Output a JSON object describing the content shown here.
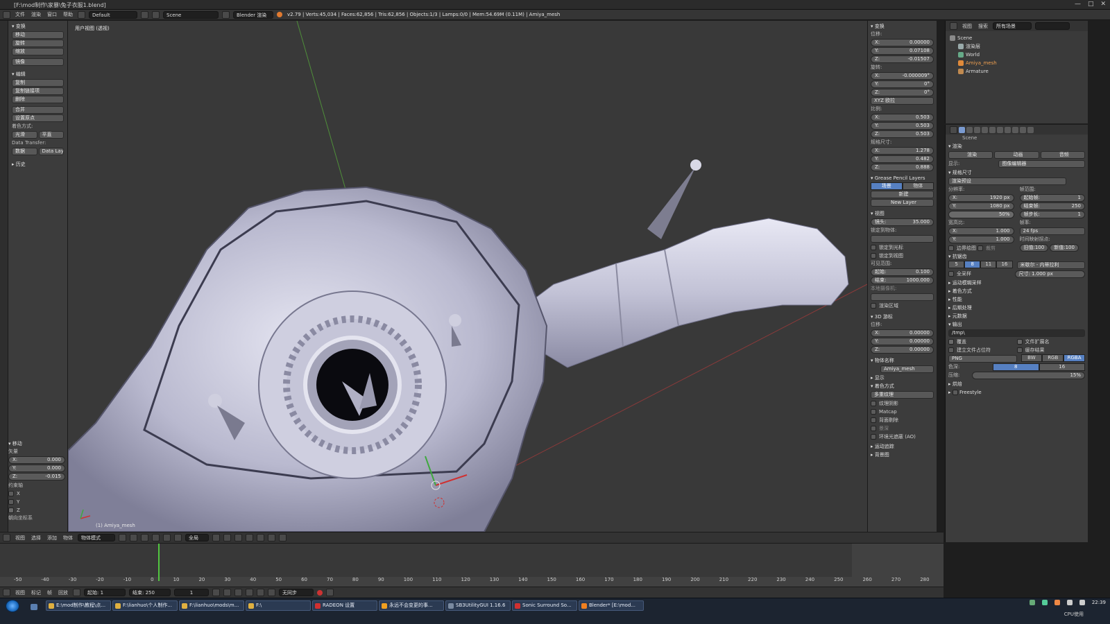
{
  "titlebar": {
    "title": "[F:\\mod制作\\家暴\\兔子衣服1.blend]"
  },
  "infobar": {
    "menus": [
      "文件",
      "渲染",
      "窗口",
      "帮助"
    ],
    "layout": "Default",
    "scene": "Scene",
    "engine": "Blender 渲染",
    "stats": "v2.79 | Verts:45,034 | Faces:62,856 | Tris:62,856 | Objects:1/3 | Lamps:0/0 | Mem:54.69M (0.11M) | Amiya_mesh"
  },
  "toolshelf": {
    "transform": {
      "header": "变换",
      "buttons": [
        "移动",
        "旋转",
        "缩放",
        "镜像"
      ]
    },
    "edit": {
      "header": "编辑",
      "buttons": [
        "复制",
        "复制链接项",
        "删除",
        "合并"
      ],
      "origin": "设置原点",
      "shading_label": "着色方式:",
      "shading": [
        "光滑",
        "平直"
      ],
      "data_transfer_label": "Data Transfer:",
      "data_transfer": [
        "数据",
        "Data Layo"
      ]
    },
    "history": "历史",
    "operator": {
      "header": "移动",
      "vector": "矢量",
      "x": "0.000",
      "y": "0.000",
      "z": "-0.015",
      "constraint": "约束轴",
      "axes": [
        "X",
        "Y",
        "Z"
      ],
      "orient": "朝向坐标系"
    }
  },
  "viewport": {
    "title": "用户视图 (透视)",
    "object": "(1) Amiya_mesh"
  },
  "viewheader": {
    "menus": [
      "视图",
      "选择",
      "添加",
      "物体"
    ],
    "mode": "物体模式",
    "pivot": "全局"
  },
  "npanel": {
    "transform": {
      "header": "变换",
      "location_label": "位移:",
      "location": {
        "x": "0.00000",
        "y": "0.07108",
        "z": "-0.01507"
      },
      "rotation_label": "旋转:",
      "rotation": {
        "x": "-0.000009°",
        "y": "0°",
        "z": "0°"
      },
      "rot_mode": "XYZ 欧拉",
      "scale_label": "比例:",
      "scale": {
        "x": "0.503",
        "y": "0.503",
        "z": "0.503"
      },
      "dims_label": "规格尺寸:",
      "dims": {
        "x": "1.278",
        "y": "0.482",
        "z": "0.888"
      }
    },
    "gpencil": {
      "header": "Grease Pencil Layers",
      "tabs": [
        "场景",
        "物体"
      ],
      "new": "新建",
      "new_layer": "New Layer"
    },
    "view": {
      "header": "视图",
      "lens": "35.000",
      "lens_label": "镜头:",
      "lock_label": "锁定到物体:",
      "lock_cursor": "锁定到光标",
      "lock_camera": "锁定到视图",
      "clip_label": "可见范围:",
      "clip_start": "0.100",
      "clip_end": "1000.000",
      "clip_start_label": "起始:",
      "clip_end_label": "结束:",
      "local_cam": "本地摄像机:",
      "render_border": "渲染区域"
    },
    "cursor": {
      "header": "3D 游标",
      "loc_label": "位移:",
      "x": "0.00000",
      "y": "0.00000",
      "z": "0.00000"
    },
    "item": {
      "header": "物体名称",
      "name": "Amiya_mesh"
    },
    "display": "显示",
    "shading": {
      "header": "着色方式",
      "mode": "多重纹理",
      "opts": [
        "纹理阴影",
        "Matcap",
        "背面剔除",
        "景深",
        "环境光遮蔽 (AO)"
      ]
    },
    "motion": "运动追踪",
    "bg": "背景图"
  },
  "outliner": {
    "menus": [
      "视图",
      "搜索"
    ],
    "filter": "所有场景",
    "items": [
      "Scene",
      "渲染层",
      "World",
      "Amiya_mesh",
      "Armature"
    ]
  },
  "props": {
    "context": "Scene",
    "render": {
      "header": "渲染",
      "tabs": [
        "渲染",
        "动画",
        "音频"
      ],
      "display_label": "显示:",
      "display": "图像编辑器"
    },
    "dimensions": {
      "header": "规格尺寸",
      "preset": "渲染预设",
      "res_label": "分辨率:",
      "res_x": "1920 px",
      "res_y": "1080 px",
      "res_pct": "50%",
      "frame_label": "帧范围:",
      "start": "1",
      "end": "250",
      "step": "1",
      "start_label": "起始帧:",
      "end_label": "结束帧:",
      "step_label": "帧步长:",
      "aspect_label": "宽高比:",
      "ax": "1.000",
      "ay": "1.000",
      "fps_label": "帧率:",
      "fps": "24 fps",
      "remap_label": "时间映射拐点:",
      "old": "旧值:100",
      "new": "新值:100",
      "border": "边界绘图",
      "crop": "裁剪"
    },
    "aa": {
      "header": "抗锯齿",
      "samples": [
        "5",
        "8",
        "11",
        "16"
      ],
      "filter": "米歇尔 - 内蒂拉利",
      "full": "全采样",
      "size": "尺寸: 1.000 px"
    },
    "sections": [
      "运动模糊采样",
      "着色方式",
      "性能",
      "后期处理",
      "元数据"
    ],
    "output": {
      "header": "输出",
      "path": "/tmp\\",
      "overwrite": "覆盖",
      "ext": "文件扩展名",
      "placeholders": "建立文件占位符",
      "cache": "缓存结果",
      "format": "PNG",
      "modes": [
        "BW",
        "RGB",
        "RGBA"
      ],
      "depth_label": "色深:",
      "depths": [
        "8",
        "16"
      ],
      "compress_label": "压缩:",
      "compress": "15%"
    },
    "bake": "烘焙",
    "freestyle": "Freestyle"
  },
  "timeline": {
    "ticks": [
      "-50",
      "-40",
      "-30",
      "-20",
      "-10",
      "0",
      "10",
      "20",
      "30",
      "40",
      "50",
      "60",
      "70",
      "80",
      "90",
      "100",
      "110",
      "120",
      "130",
      "140",
      "150",
      "160",
      "170",
      "180",
      "190",
      "200",
      "210",
      "220",
      "230",
      "240",
      "250",
      "260",
      "270",
      "280"
    ],
    "current_frame": 2,
    "menus": [
      "视图",
      "标记",
      "帧",
      "回放"
    ],
    "start": "起始: 1",
    "end": "结束: 250",
    "frame": "1",
    "sync": "无同步"
  },
  "taskbar": {
    "tasks": [
      {
        "label": "E:\\mod制作\\教程\\点...",
        "color": "#e0b040"
      },
      {
        "label": "F:\\lianhuo\\个人制作...",
        "color": "#e0b040"
      },
      {
        "label": "F:\\lianhuo\\mods\\m...",
        "color": "#e0b040"
      },
      {
        "label": "F:\\",
        "color": "#e0b040"
      },
      {
        "label": "RADEON 设置",
        "color": "#d03030"
      },
      {
        "label": "永远不会变更的事...",
        "color": "#f0a020"
      },
      {
        "label": "SB3UtilityGUI 1.16.6",
        "color": "#7a8aa0"
      },
      {
        "label": "Sonic Surround So...",
        "color": "#d03030"
      },
      {
        "label": "Blender* [E:\\mod...",
        "color": "#f08020"
      }
    ],
    "clock": "22:39",
    "cpu": "CPU使用"
  }
}
